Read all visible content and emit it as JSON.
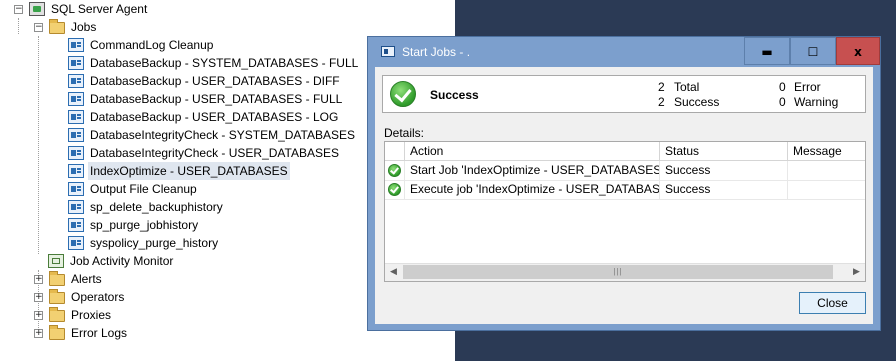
{
  "tree": {
    "root": {
      "expander": "−",
      "label": "SQL Server Agent",
      "icon": "agent-icon"
    },
    "jobs_folder": {
      "expander": "−",
      "label": "Jobs",
      "icon": "folder-icon"
    },
    "jobs": [
      "CommandLog Cleanup",
      "DatabaseBackup - SYSTEM_DATABASES - FULL",
      "DatabaseBackup - USER_DATABASES - DIFF",
      "DatabaseBackup - USER_DATABASES - FULL",
      "DatabaseBackup - USER_DATABASES - LOG",
      "DatabaseIntegrityCheck - SYSTEM_DATABASES",
      "DatabaseIntegrityCheck - USER_DATABASES",
      "IndexOptimize - USER_DATABASES",
      "Output File Cleanup",
      "sp_delete_backuphistory",
      "sp_purge_jobhistory",
      "syspolicy_purge_history"
    ],
    "selected_job": "IndexOptimize - USER_DATABASES",
    "job_activity_monitor": "Job Activity Monitor",
    "folders": [
      {
        "expander": "+",
        "label": "Alerts"
      },
      {
        "expander": "+",
        "label": "Operators"
      },
      {
        "expander": "+",
        "label": "Proxies"
      },
      {
        "expander": "+",
        "label": "Error Logs"
      }
    ]
  },
  "dialog": {
    "title": "Start Jobs - .",
    "buttons": {
      "minimize": "▬",
      "maximize": "☐",
      "close": "x"
    },
    "summary": {
      "status": "Success",
      "total_count": "2",
      "total_label": "Total",
      "success_count": "2",
      "success_label": "Success",
      "error_count": "0",
      "error_label": "Error",
      "warning_count": "0",
      "warning_label": "Warning"
    },
    "details_label": "Details:",
    "grid": {
      "columns": [
        "",
        "Action",
        "Status",
        "Message"
      ],
      "rows": [
        {
          "action": "Start Job 'IndexOptimize - USER_DATABASES'",
          "status": "Success",
          "message": ""
        },
        {
          "action": "Execute job 'IndexOptimize - USER_DATABASES'",
          "status": "Success",
          "message": ""
        }
      ],
      "scroll_left": "◀",
      "scroll_right": "▶",
      "scroll_thumb": "|||"
    },
    "close_label": "Close"
  },
  "colors": {
    "title_bar": "#7c9fcd",
    "desktop": "#2b3a55",
    "close_button": "#c75050",
    "selection": "#dfe6ef"
  }
}
